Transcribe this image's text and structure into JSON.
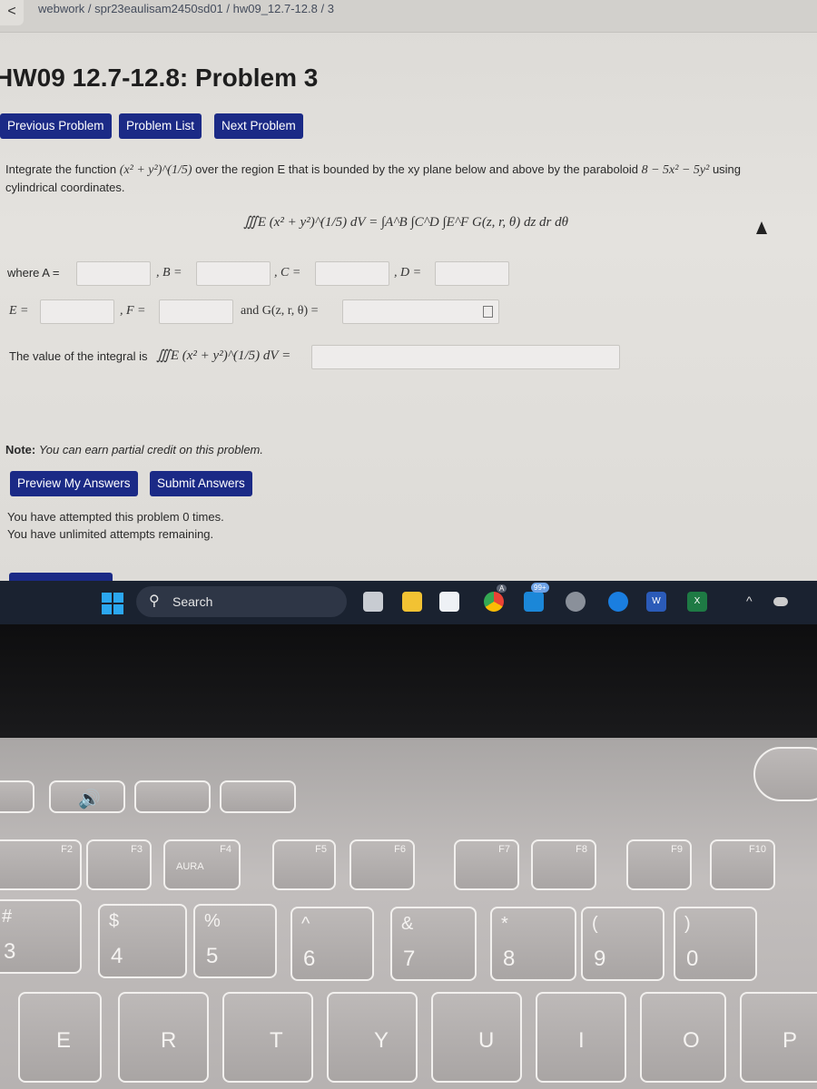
{
  "breadcrumb": "webwork / spr23eaulisam2450sd01 / hw09_12.7-12.8 / 3",
  "title": "HW09 12.7-12.8: Problem 3",
  "nav": {
    "previous": "Previous Problem",
    "list": "Problem List",
    "next": "Next Problem"
  },
  "problem": {
    "statement_1": "Integrate the function",
    "function": "(x² + y²)^(1/5)",
    "statement_2": "over the region E that is bounded by the xy plane below and above by the paraboloid",
    "paraboloid": "8 − 5x² − 5y²",
    "statement_3": "using",
    "statement_4": "cylindrical coordinates.",
    "equation_lhs": "∭E (x² + y²)^(1/5) dV =",
    "equation_rhs": "∫A^B ∫C^D ∫E^F G(z, r, θ) dz dr dθ",
    "labels": {
      "A": "where A =",
      "B": ", B =",
      "C": ", C =",
      "D": ", D =",
      "E": "E =",
      "F": ", F =",
      "G": "and G(z, r, θ) =",
      "value": "The value of the integral is",
      "value_expr": "∭E (x² + y²)^(1/5) dV ="
    },
    "answers": {
      "A": "",
      "B": "",
      "C": "",
      "D": "",
      "E": "",
      "F": "",
      "G": "",
      "value": ""
    }
  },
  "note_label": "Note:",
  "note": "You can earn partial credit on this problem.",
  "actions": {
    "preview": "Preview My Answers",
    "submit": "Submit Answers"
  },
  "status": [
    "You have attempted this problem 0 times.",
    "You have unlimited attempts remaining."
  ],
  "taskbar": {
    "search": "Search",
    "mail_badge": "99+",
    "chrome_badge": "A",
    "word": "W",
    "excel": "X"
  },
  "keyboard": {
    "fn_row": [
      "F2",
      "F3",
      "F4",
      "F5",
      "F6",
      "F7",
      "F8",
      "F9",
      "F10"
    ],
    "aura": "AURA",
    "number_row": [
      [
        "#",
        "3"
      ],
      [
        "$",
        "4"
      ],
      [
        "%",
        "5"
      ],
      [
        "^",
        "6"
      ],
      [
        "&",
        "7"
      ],
      [
        "*",
        "8"
      ],
      [
        "(",
        "9"
      ],
      [
        ")",
        "0"
      ]
    ],
    "letter_row": [
      "E",
      "R",
      "T",
      "Y",
      "U",
      "I",
      "O",
      "P"
    ]
  },
  "colors": {
    "button": "#1b2a86",
    "taskbar": "#1a2230"
  }
}
